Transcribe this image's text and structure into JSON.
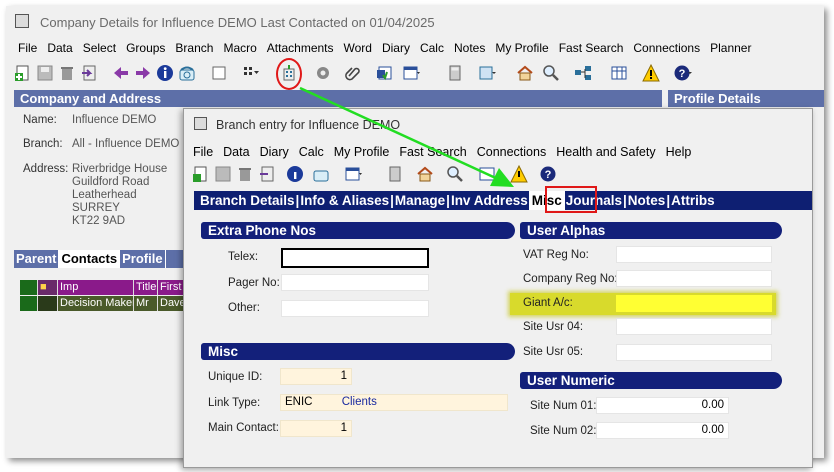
{
  "main_window": {
    "title": "Company Details for Influence DEMO   Last Contacted on 01/04/2025",
    "menu": [
      "File",
      "Data",
      "Select",
      "Groups",
      "Branch",
      "Macro",
      "Attachments",
      "Word",
      "Diary",
      "Calc",
      "Notes",
      "My Profile",
      "Fast Search",
      "Connections",
      "Planner"
    ],
    "section_company": "Company and Address",
    "section_profile": "Profile Details",
    "name_label": "Name:",
    "name_value": "Influence DEMO",
    "branch_label": "Branch:",
    "branch_value": "All - Influence DEMO",
    "address_label": "Address:",
    "address_lines": [
      "Riverbridge House",
      "Guildford Road",
      "Leatherhead",
      "SURREY",
      "KT22 9AD"
    ],
    "tabs": [
      "Parent",
      "Contacts",
      "Profile"
    ],
    "active_tab": "Contacts",
    "grid_headers": [
      "Imp",
      "Title",
      "First"
    ],
    "grid_row": [
      "Decision Maker",
      "Mr",
      "Dave"
    ]
  },
  "dialog": {
    "title": "Branch entry for Influence DEMO",
    "menu": [
      "File",
      "Data",
      "Diary",
      "Calc",
      "My Profile",
      "Fast Search",
      "Connections",
      "Health and Safety",
      "Help"
    ],
    "tabs": [
      "Branch Details",
      "Info & Aliases",
      "Manage",
      "Inv Address",
      "Misc",
      "Journals",
      "Notes",
      "Attribs"
    ],
    "active_tab": "Misc",
    "extra_phone": {
      "heading": "Extra Phone Nos",
      "telex_label": "Telex:",
      "telex_value": "",
      "pager_label": "Pager No:",
      "pager_value": "",
      "other_label": "Other:",
      "other_value": ""
    },
    "misc": {
      "heading": "Misc",
      "unique_id_label": "Unique ID:",
      "unique_id_value": "1",
      "link_type_label": "Link Type:",
      "link_type_code": "ENIC",
      "link_type_value": "Clients",
      "main_contact_label": "Main Contact:",
      "main_contact_value": "1"
    },
    "user_alphas": {
      "heading": "User Alphas",
      "vat_label": "VAT Reg No:",
      "vat_value": "",
      "company_reg_label": "Company Reg No:",
      "company_reg_value": "",
      "giant_label": "Giant A/c:",
      "giant_value": "",
      "site_usr_04_label": "Site Usr 04:",
      "site_usr_04_value": "",
      "site_usr_05_label": "Site Usr 05:",
      "site_usr_05_value": ""
    },
    "user_numeric": {
      "heading": "User Numeric",
      "site_num_01_label": "Site Num 01:",
      "site_num_01_value": "0.00",
      "site_num_02_label": "Site Num 02:",
      "site_num_02_value": "0.00"
    }
  },
  "colors": {
    "main_section": "#5d6fa8",
    "dialog_header": "#13207a",
    "annotation_red": "#e01818",
    "annotation_arrow": "#22dd22",
    "highlight_yellow": "#ffff33"
  },
  "icons": [
    "new-record-icon",
    "save-icon",
    "delete-icon",
    "export-icon",
    "back-arrow-icon",
    "forward-arrow-icon",
    "info-icon",
    "phone-icon",
    "blank-doc-icon",
    "grid-menu-icon",
    "branch-icon",
    "settings-icon",
    "attachment-icon",
    "word-icon",
    "calendar-icon",
    "calculator-icon",
    "notes-icon",
    "home-icon",
    "search-icon",
    "connections-icon",
    "planner-icon",
    "warning-icon",
    "help-icon"
  ]
}
